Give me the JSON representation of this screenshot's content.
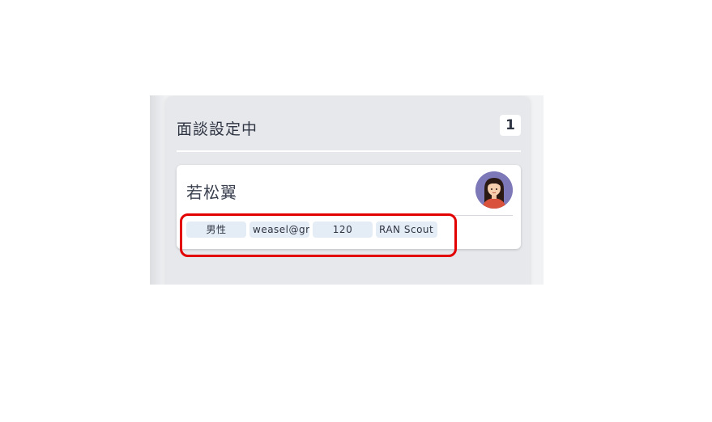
{
  "column": {
    "title": "面談設定中",
    "count": "1"
  },
  "card": {
    "name": "若松翼",
    "avatar_icon": "woman-avatar-icon",
    "tags": {
      "gender": "男性",
      "email": "weasel@gmail.com",
      "number": "120",
      "source": "RAN Scout"
    }
  },
  "annotation": {
    "highlight_color": "#e30000"
  }
}
